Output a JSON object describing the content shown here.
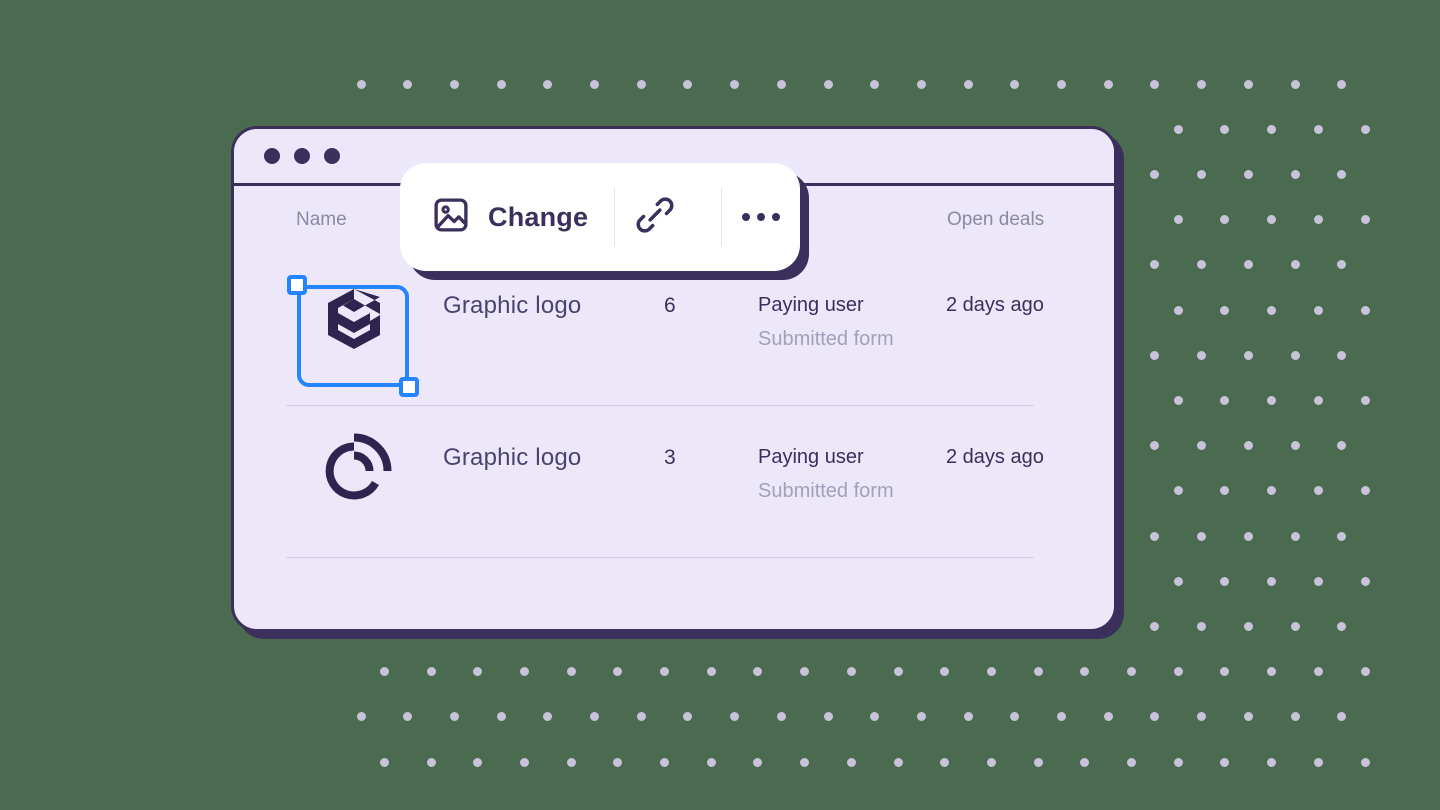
{
  "background": {
    "color": "#4a6b4f",
    "dot_color": "#c8c3da",
    "dot_pattern": "staggered-grid"
  },
  "window": {
    "frame_color": "#3b2f5c",
    "surface_color": "#ece8f9",
    "traffic_lights": [
      "dot-1",
      "dot-2",
      "dot-3"
    ]
  },
  "table": {
    "columns": [
      {
        "key": "name",
        "label": "Name"
      },
      {
        "key": "open_deals",
        "label": "Open deals"
      }
    ],
    "rows": [
      {
        "logo": "hexagon-layers-logo",
        "title": "Graphic logo",
        "count": "6",
        "status": "Paying user",
        "substatus": "Submitted form",
        "time": "2 days ago",
        "selected": true
      },
      {
        "logo": "concentric-arcs-logo",
        "title": "Graphic logo",
        "count": "3",
        "status": "Paying user",
        "substatus": "Submitted form",
        "time": "2 days ago",
        "selected": false
      }
    ]
  },
  "toolbar": {
    "change_label": "Change",
    "image_icon": "image-icon",
    "link_icon": "link-icon",
    "more_icon": "ellipsis-icon",
    "surface_color": "#ffffff",
    "shadow_color": "#3b2f5c"
  },
  "selection": {
    "accent_color": "#2684ff",
    "handles": [
      "top-left",
      "bottom-right"
    ]
  }
}
